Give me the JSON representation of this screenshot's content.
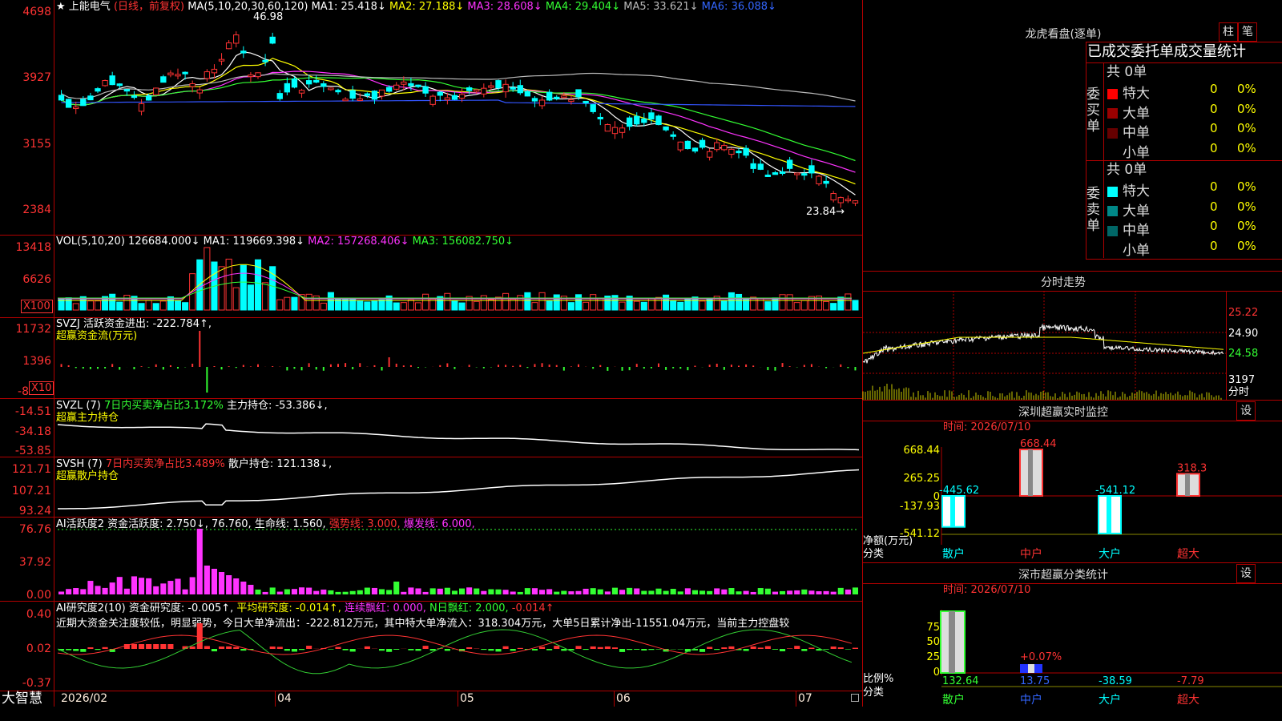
{
  "chart_title": {
    "star": "★",
    "stock": "上能电气",
    "period": "(日线，前复权)",
    "ma_def": "MA(5,10,20,30,60,120)",
    "ma1": "MA1: 25.418↓",
    "ma2": "MA2: 27.188↓",
    "ma3": "MA3: 28.608↓",
    "ma4": "MA4: 29.404↓",
    "ma5": "MA5: 33.621↓",
    "ma6": "MA6: 36.088↓"
  },
  "price_axis": [
    "4698",
    "3927",
    "3155",
    "2384"
  ],
  "price_marks": {
    "high": "46.98",
    "low": "23.84→"
  },
  "vol": {
    "title": "VOL(5,10,20)",
    "value": "126684.000↓",
    "ma1": "MA1: 119669.398↓",
    "ma2": "MA2: 157268.406↓",
    "ma3": "MA3: 156082.750↓",
    "axis": [
      "13418",
      "6626",
      "X100"
    ]
  },
  "svzj": {
    "title": "SVZJ  活跃资金进出: -222.784↑,",
    "subtitle": "超赢资金流(万元)",
    "axis": [
      "11732",
      "1396",
      "-8",
      "X10"
    ]
  },
  "svzl": {
    "title": "SVZL (7)",
    "ratio": "7日内买卖净占比3.172%",
    "hold": "主力持仓: -53.386↓,",
    "subtitle": "超赢主力持仓",
    "axis": [
      "-14.51",
      "-34.18",
      "-53.85"
    ]
  },
  "svsh": {
    "title": "SVSH (7)",
    "ratio": "7日内买卖净占比3.489%",
    "hold": "散户持仓: 121.138↓,",
    "subtitle": "超赢散户持仓",
    "axis": [
      "121.71",
      "107.21",
      "93.24"
    ]
  },
  "ai_active": {
    "title": "AI活跃度2",
    "a": "资金活跃度: 2.750↓,",
    "b": "76.760,",
    "c": "生命线: 1.560,",
    "d": "强势线: 3.000,",
    "e": "爆发线: 6.000,",
    "axis": [
      "76.76",
      "37.92",
      "0.00"
    ]
  },
  "ai_research": {
    "title": "AI研究度2(10)",
    "a": "资金研究度: -0.005↑,",
    "b": "平均研究度: -0.014↑,",
    "c": "连续飘红: 0.000,",
    "d": "N日飘红: 2.000,",
    "e": "-0.014↑",
    "comment": "近期大资金关注度较低，明显弱势，今日大单净流出：-222.812万元，其中特大单净流入：318.304万元，大单5日累计净出-11551.04万元，当前主力控盘较",
    "axis": [
      "0.40",
      "0.02",
      "-0.37"
    ]
  },
  "bottom": {
    "logo": "大智慧",
    "dates": [
      "2026/02",
      "04",
      "05",
      "06",
      "07"
    ]
  },
  "dragon": {
    "title": "龙虎看盘(逐单)",
    "btn1": "柱",
    "btn2": "笔",
    "header": "已成交委托单成交量统计",
    "buy_label": "委买单",
    "sell_label": "委卖单",
    "buy_total": "共 0单",
    "sell_total": "共 0单",
    "buy_rows": [
      {
        "name": "特大",
        "count": "0",
        "pct": "0%",
        "color": "#ff0000"
      },
      {
        "name": "大单",
        "count": "0",
        "pct": "0%",
        "color": "#990000"
      },
      {
        "name": "中单",
        "count": "0",
        "pct": "0%",
        "color": "#660000"
      },
      {
        "name": "小单",
        "count": "0",
        "pct": "0%",
        "color": "#000000"
      }
    ],
    "sell_rows": [
      {
        "name": "特大",
        "count": "0",
        "pct": "0%",
        "color": "#00ffff"
      },
      {
        "name": "大单",
        "count": "0",
        "pct": "0%",
        "color": "#008888"
      },
      {
        "name": "中单",
        "count": "0",
        "pct": "0%",
        "color": "#006666"
      },
      {
        "name": "小单",
        "count": "0",
        "pct": "0%",
        "color": "#000000"
      }
    ]
  },
  "intraday": {
    "title": "分时走势",
    "axis": [
      "25.22",
      "24.90",
      "24.58"
    ],
    "vol_axis": [
      "3197",
      "分时"
    ]
  },
  "sz_monitor": {
    "title": "深圳超赢实时监控",
    "btn": "设",
    "date": "时间: 2026/07/10",
    "axis": [
      "668.44",
      "265.25",
      "0",
      "-137.93",
      "-541.12"
    ],
    "ylabel1": "净额(万元)",
    "ylabel2": "分类",
    "bars": [
      {
        "name": "散户",
        "value": -445.62,
        "label": "-445.62"
      },
      {
        "name": "中户",
        "value": 668.44,
        "label": "668.44"
      },
      {
        "name": "大户",
        "value": -541.12,
        "label": "-541.12"
      },
      {
        "name": "超大",
        "value": 318.3,
        "label": "318.3"
      }
    ]
  },
  "sz_class": {
    "title": "深市超赢分类统计",
    "btn": "设",
    "date": "时间: 2026/07/10",
    "axis": [
      "75",
      "50",
      "25",
      "0"
    ],
    "ylabel1": "比例%",
    "ylabel2": "分类",
    "bars": [
      {
        "name": "散户",
        "value": "132.64"
      },
      {
        "name": "中户",
        "value": "13.75"
      },
      {
        "name": "大户",
        "value": "-38.59"
      },
      {
        "name": "超大",
        "value": "-7.79"
      }
    ],
    "mid_label": "+0.07%"
  },
  "colors": {
    "up": "#ff3333",
    "down": "#00ffff",
    "grid": "#b00000"
  }
}
